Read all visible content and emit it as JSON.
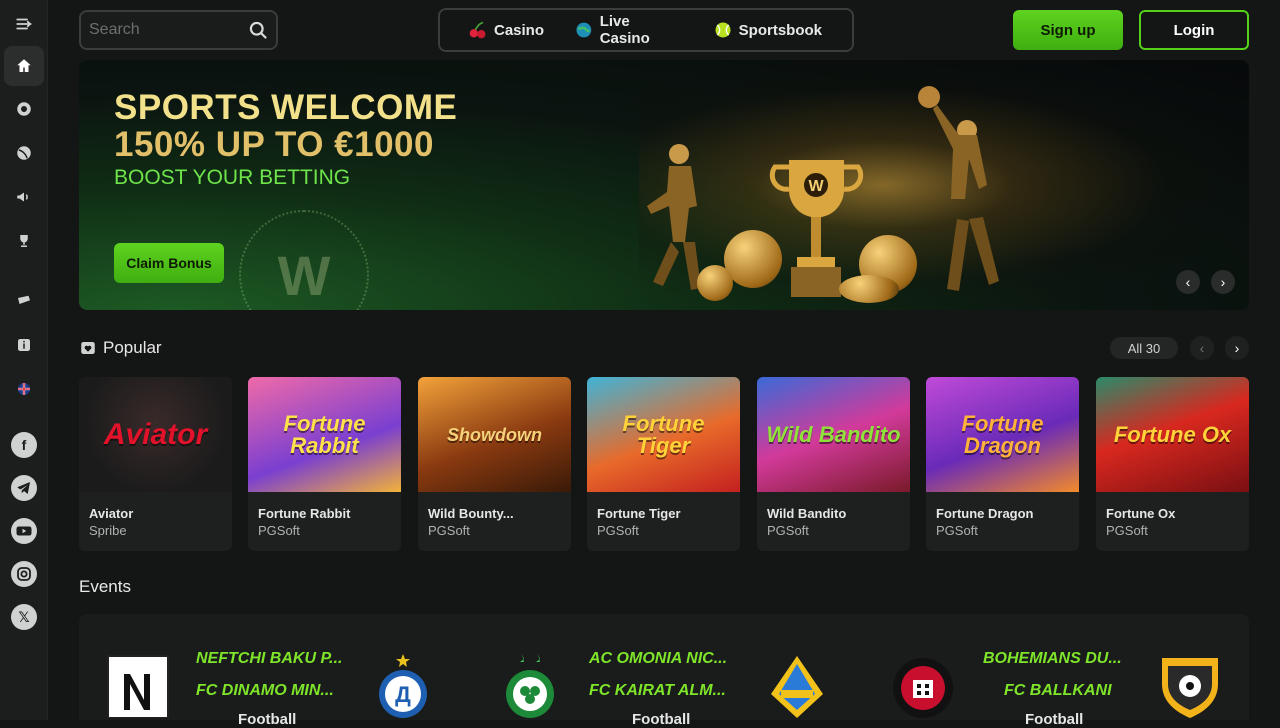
{
  "search": {
    "placeholder": "Search"
  },
  "nav": {
    "tabs": [
      {
        "label": "Casino",
        "icon": "cherry-icon"
      },
      {
        "label": "Live Casino",
        "icon": "globe-icon"
      },
      {
        "label": "Sportsbook",
        "icon": "tennis-ball-icon"
      }
    ]
  },
  "auth": {
    "signup_label": "Sign up",
    "login_label": "Login"
  },
  "banner": {
    "title_line1": "SPORTS WELCOME",
    "title_line2": "150% UP TO €1000",
    "subtitle": "BOOST YOUR BETTING",
    "cta_label": "Claim Bonus",
    "logo_letter": "W"
  },
  "popular": {
    "title": "Popular",
    "all_label": "All 30",
    "games": [
      {
        "name": "Aviator",
        "provider": "Spribe",
        "thumb_text": "Aviator"
      },
      {
        "name": "Fortune Rabbit",
        "provider": "PGSoft",
        "thumb_text": "Fortune Rabbit"
      },
      {
        "name": "Wild Bounty...",
        "provider": "PGSoft",
        "thumb_text": "Showdown"
      },
      {
        "name": "Fortune Tiger",
        "provider": "PGSoft",
        "thumb_text": "Fortune Tiger"
      },
      {
        "name": "Wild Bandito",
        "provider": "PGSoft",
        "thumb_text": "Wild Bandito"
      },
      {
        "name": "Fortune Dragon",
        "provider": "PGSoft",
        "thumb_text": "Fortune Dragon"
      },
      {
        "name": "Fortune Ox",
        "provider": "PGSoft",
        "thumb_text": "Fortune Ox"
      }
    ]
  },
  "events": {
    "title": "Events",
    "matches": [
      {
        "home": "NEFTCHI BAKU P...",
        "away": "FC DINAMO MIN...",
        "sport": "Football"
      },
      {
        "home": "AC OMONIA NIC...",
        "away": "FC KAIRAT ALM...",
        "sport": "Football"
      },
      {
        "home": "BOHEMIANS DU...",
        "away": "FC BALLKANI",
        "sport": "Football"
      }
    ]
  },
  "colors": {
    "accent_green": "#4cc317",
    "banner_gold": "#f2e08a",
    "text_green": "#7ee52a"
  }
}
